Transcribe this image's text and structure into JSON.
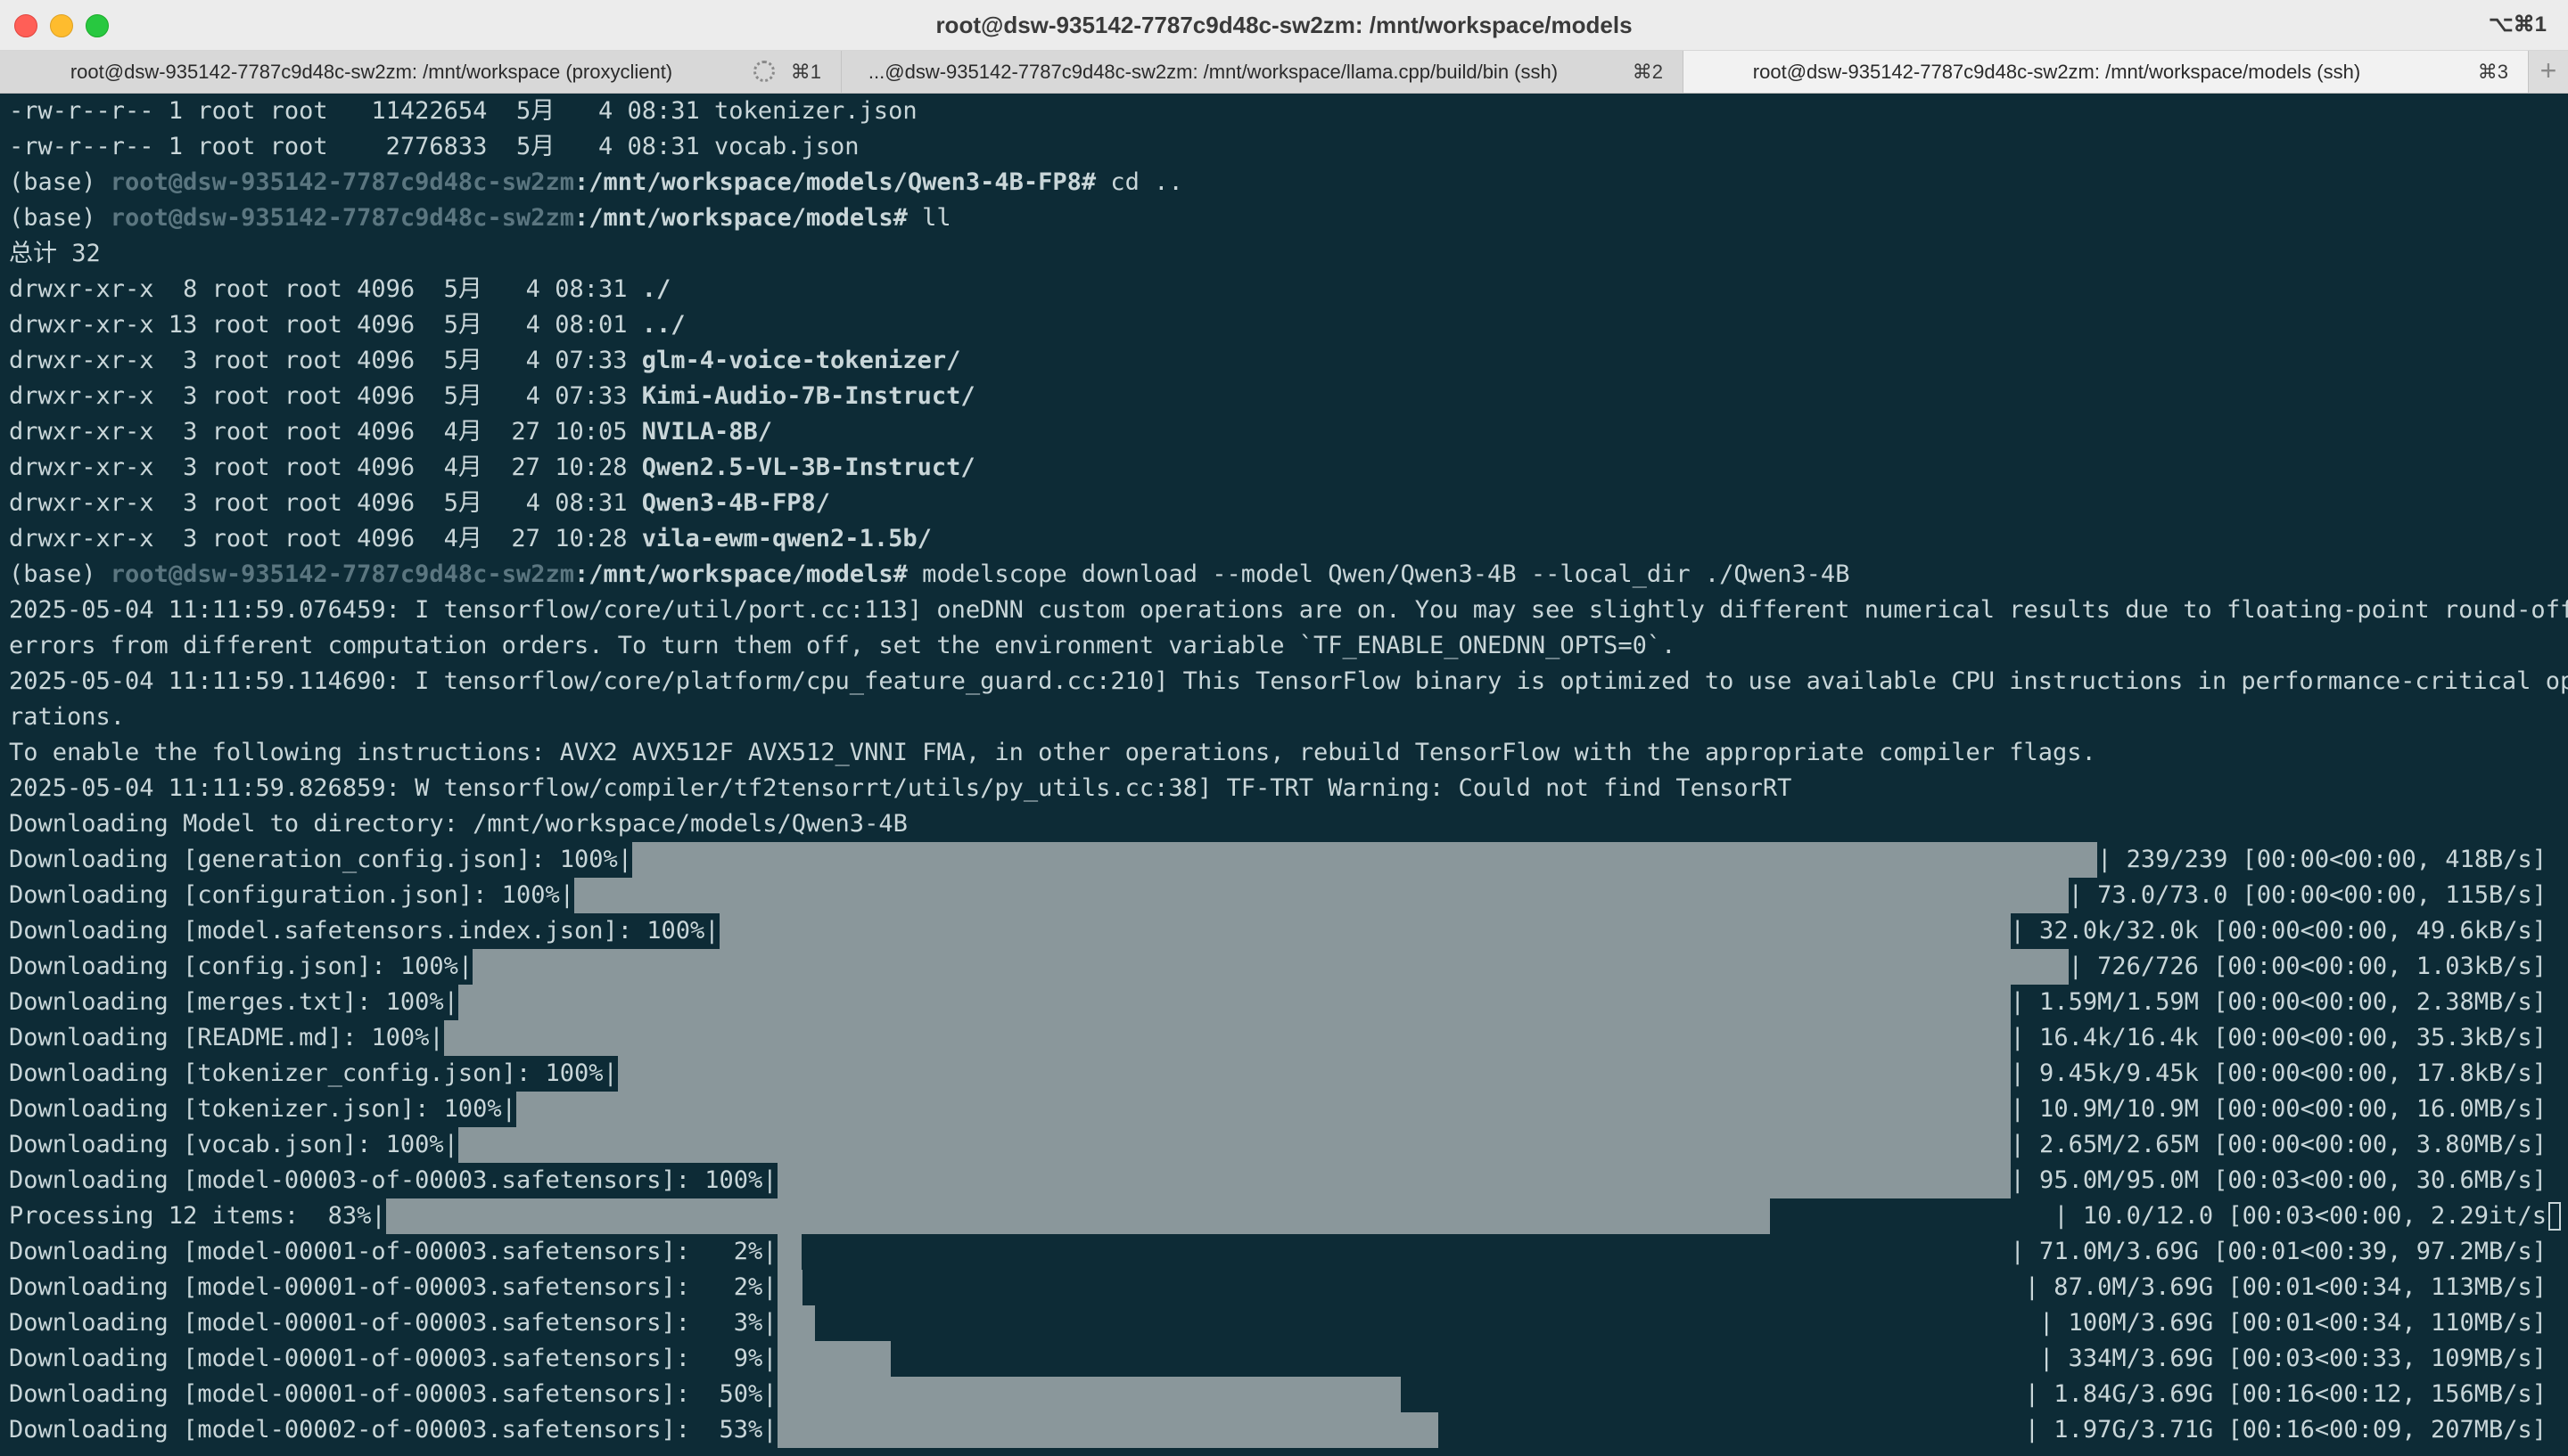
{
  "window": {
    "title": "root@dsw-935142-7787c9d48c-sw2zm: /mnt/workspace/models",
    "shortcut": "⌥⌘1"
  },
  "tabs": [
    {
      "label": "root@dsw-935142-7787c9d48c-sw2zm: /mnt/workspace (proxyclient)",
      "key": "⌘1",
      "active": false
    },
    {
      "label": "...@dsw-935142-7787c9d48c-sw2zm: /mnt/workspace/llama.cpp/build/bin (ssh)",
      "key": "⌘2",
      "active": false
    },
    {
      "label": "root@dsw-935142-7787c9d48c-sw2zm: /mnt/workspace/models (ssh)",
      "key": "⌘3",
      "active": true
    }
  ],
  "new_tab": "+",
  "terminal": {
    "file_lines": [
      "-rw-r--r-- 1 root root   11422654  5月   4 08:31 tokenizer.json",
      "-rw-r--r-- 1 root root    2776833  5月   4 08:31 vocab.json"
    ],
    "prompt1": {
      "env": "(base) ",
      "user": "root@dsw-935142-7787c9d48c-sw2zm",
      "path": ":/mnt/workspace/models/Qwen3-4B-FP8#",
      "cmd": " cd .."
    },
    "prompt2": {
      "env": "(base) ",
      "user": "root@dsw-935142-7787c9d48c-sw2zm",
      "path": ":/mnt/workspace/models#",
      "cmd": " ll"
    },
    "total": "总计 32",
    "dir_lines": [
      {
        "meta": "drwxr-xr-x  8 root root 4096  5月   4 08:31 ",
        "name": "./"
      },
      {
        "meta": "drwxr-xr-x 13 root root 4096  5月   4 08:01 ",
        "name": "../"
      },
      {
        "meta": "drwxr-xr-x  3 root root 4096  5月   4 07:33 ",
        "name": "glm-4-voice-tokenizer/"
      },
      {
        "meta": "drwxr-xr-x  3 root root 4096  5月   4 07:33 ",
        "name": "Kimi-Audio-7B-Instruct/"
      },
      {
        "meta": "drwxr-xr-x  3 root root 4096  4月  27 10:05 ",
        "name": "NVILA-8B/"
      },
      {
        "meta": "drwxr-xr-x  3 root root 4096  4月  27 10:28 ",
        "name": "Qwen2.5-VL-3B-Instruct/"
      },
      {
        "meta": "drwxr-xr-x  3 root root 4096  5月   4 08:31 ",
        "name": "Qwen3-4B-FP8/"
      },
      {
        "meta": "drwxr-xr-x  3 root root 4096  4月  27 10:28 ",
        "name": "vila-ewm-qwen2-1.5b/"
      }
    ],
    "prompt3": {
      "env": "(base) ",
      "user": "root@dsw-935142-7787c9d48c-sw2zm",
      "path": ":/mnt/workspace/models#",
      "cmd": " modelscope download --model Qwen/Qwen3-4B --local_dir ./Qwen3-4B"
    },
    "log_lines": [
      "2025-05-04 11:11:59.076459: I tensorflow/core/util/port.cc:113] oneDNN custom operations are on. You may see slightly different numerical results due to floating-point round-off",
      "errors from different computation orders. To turn them off, set the environment variable `TF_ENABLE_ONEDNN_OPTS=0`.",
      "2025-05-04 11:11:59.114690: I tensorflow/core/platform/cpu_feature_guard.cc:210] This TensorFlow binary is optimized to use available CPU instructions in performance-critical ope",
      "rations.",
      "To enable the following instructions: AVX2 AVX512F AVX512_VNNI FMA, in other operations, rebuild TensorFlow with the appropriate compiler flags.",
      "2025-05-04 11:11:59.826859: W tensorflow/compiler/tf2tensorrt/utils/py_utils.cc:38] TF-TRT Warning: Could not find TensorRT",
      "Downloading Model to directory: /mnt/workspace/models/Qwen3-4B"
    ],
    "progress": [
      {
        "label": "Downloading [generation_config.json]: 100%|",
        "pct": 100,
        "stats": "| 239/239 [00:00<00:00, 418B/s]"
      },
      {
        "label": "Downloading [configuration.json]: 100%|",
        "pct": 100,
        "stats": "| 73.0/73.0 [00:00<00:00, 115B/s]"
      },
      {
        "label": "Downloading [model.safetensors.index.json]: 100%|",
        "pct": 100,
        "stats": "| 32.0k/32.0k [00:00<00:00, 49.6kB/s]"
      },
      {
        "label": "Downloading [config.json]: 100%|",
        "pct": 100,
        "stats": "| 726/726 [00:00<00:00, 1.03kB/s]"
      },
      {
        "label": "Downloading [merges.txt]: 100%|",
        "pct": 100,
        "stats": "| 1.59M/1.59M [00:00<00:00, 2.38MB/s]"
      },
      {
        "label": "Downloading [README.md]: 100%|",
        "pct": 100,
        "stats": "| 16.4k/16.4k [00:00<00:00, 35.3kB/s]"
      },
      {
        "label": "Downloading [tokenizer_config.json]: 100%|",
        "pct": 100,
        "stats": "| 9.45k/9.45k [00:00<00:00, 17.8kB/s]"
      },
      {
        "label": "Downloading [tokenizer.json]: 100%|",
        "pct": 100,
        "stats": "| 10.9M/10.9M [00:00<00:00, 16.0MB/s]"
      },
      {
        "label": "Downloading [vocab.json]: 100%|",
        "pct": 100,
        "stats": "| 2.65M/2.65M [00:00<00:00, 3.80MB/s]"
      },
      {
        "label": "Downloading [model-00003-of-00003.safetensors]: 100%|",
        "pct": 100,
        "stats": "| 95.0M/95.0M [00:03<00:00, 30.6MB/s]"
      },
      {
        "label": "Processing 12 items:  83%|",
        "pct": 83,
        "stats": "| 10.0/12.0 [00:03<00:00, 2.29it/s",
        "cursor": true
      },
      {
        "label": "Downloading [model-00001-of-00003.safetensors]:   2%|",
        "pct": 2,
        "stats": "| 71.0M/3.69G [00:01<00:39, 97.2MB/s]"
      },
      {
        "label": "Downloading [model-00001-of-00003.safetensors]:   2%|",
        "pct": 2,
        "stats": "| 87.0M/3.69G [00:01<00:34, 113MB/s]"
      },
      {
        "label": "Downloading [model-00001-of-00003.safetensors]:   3%|",
        "pct": 3,
        "stats": "| 100M/3.69G [00:01<00:34, 110MB/s]"
      },
      {
        "label": "Downloading [model-00001-of-00003.safetensors]:   9%|",
        "pct": 9,
        "stats": "| 334M/3.69G [00:03<00:33, 109MB/s]"
      },
      {
        "label": "Downloading [model-00001-of-00003.safetensors]:  50%|",
        "pct": 50,
        "stats": "| 1.84G/3.69G [00:16<00:12, 156MB/s]"
      },
      {
        "label": "Downloading [model-00002-of-00003.safetensors]:  53%|",
        "pct": 53,
        "stats": "| 1.97G/3.71G [00:16<00:09, 207MB/s]"
      }
    ]
  }
}
